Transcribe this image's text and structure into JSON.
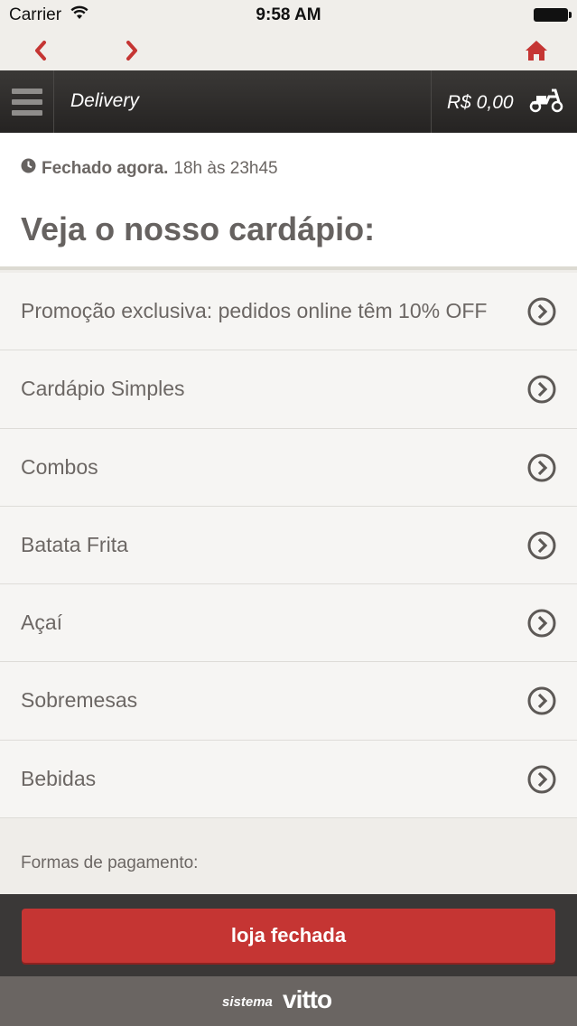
{
  "status_bar": {
    "carrier": "Carrier",
    "time": "9:58 AM"
  },
  "header": {
    "title": "Delivery",
    "cart_total": "R$ 0,00"
  },
  "store": {
    "status": "Fechado agora.",
    "hours": "18h às 23h45"
  },
  "menu": {
    "title": "Veja o nosso cardápio:",
    "items": [
      {
        "label": "Promoção exclusiva: pedidos online têm 10% OFF"
      },
      {
        "label": "Cardápio Simples"
      },
      {
        "label": "Combos"
      },
      {
        "label": "Batata Frita"
      },
      {
        "label": "Açaí"
      },
      {
        "label": "Sobremesas"
      },
      {
        "label": "Bebidas"
      }
    ]
  },
  "payments": {
    "label": "Formas de pagamento:"
  },
  "footer": {
    "button_label": "loja fechada",
    "brand_small": "sistema",
    "brand_big": "vitto"
  },
  "colors": {
    "accent": "#c53533",
    "header": "#2e2c2b",
    "text": "#6c6764"
  },
  "icons": [
    "wifi-icon",
    "battery-icon",
    "back-arrow-icon",
    "forward-arrow-icon",
    "home-icon",
    "menu-icon",
    "scooter-icon",
    "clock-icon",
    "chevron-right-circle-icon"
  ]
}
